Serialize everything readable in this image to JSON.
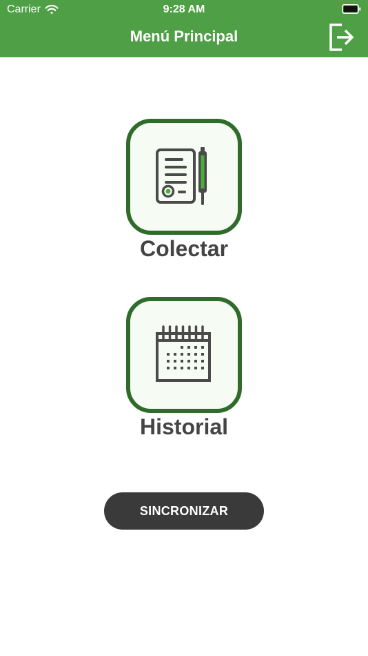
{
  "status_bar": {
    "carrier": "Carrier",
    "time": "9:28 AM"
  },
  "nav": {
    "title": "Menú Principal",
    "logout_icon": "logout-icon"
  },
  "menu": {
    "collect": {
      "label": "Colectar",
      "icon": "form-pen-icon"
    },
    "history": {
      "label": "Historial",
      "icon": "calendar-icon"
    }
  },
  "sync_button": {
    "label": "SINCRONIZAR"
  },
  "colors": {
    "header": "#4e9f45",
    "tile_border": "#2f6b2a",
    "tile_bg": "#f6fcf3",
    "accent_green": "#4cae3a",
    "icon_gray": "#4a4a4a",
    "button_dark": "#3a3a3a"
  }
}
